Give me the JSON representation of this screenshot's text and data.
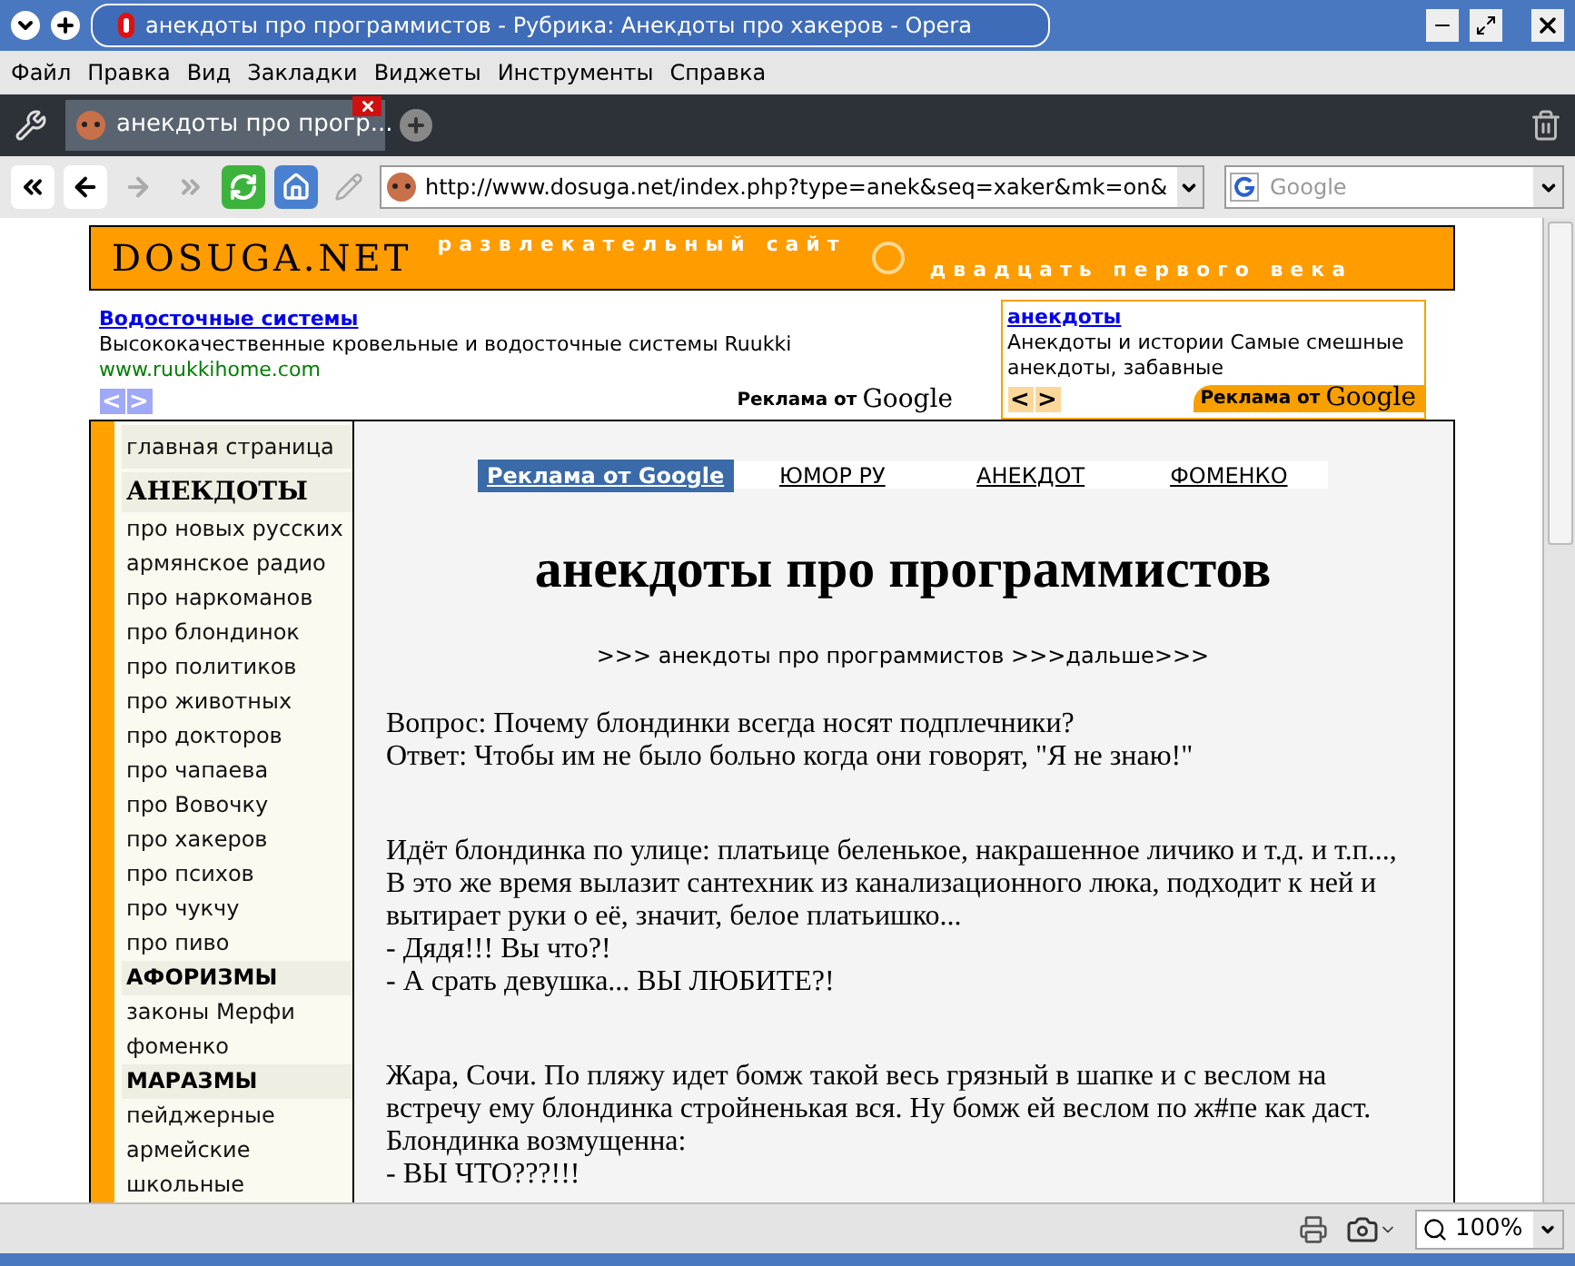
{
  "window": {
    "title": "анекдоты про программистов - Рубрика: Анекдоты про хакеров - Opera"
  },
  "menu": [
    "Файл",
    "Правка",
    "Вид",
    "Закладки",
    "Виджеты",
    "Инструменты",
    "Справка"
  ],
  "tabs": [
    {
      "label": "анекдоты про прогр...",
      "selected": true
    }
  ],
  "address_bar": {
    "url": "http://www.dosuga.net/index.php?type=anek&seq=xaker&mk=on&",
    "search_placeholder": "Google"
  },
  "header": {
    "logo": "DOSUGA.NET",
    "tagline_1": "развлекательный сайт",
    "tagline_2": "двадцать первого века"
  },
  "ad_left": {
    "title": "Водосточные системы",
    "text": "Высококачественные кровельные и водосточные системы Ruukki",
    "url": "www.ruukkihome.com",
    "prev": "<",
    "next": ">",
    "label": "Реклама от",
    "brand": "Google"
  },
  "ad_right": {
    "title": "анекдоты",
    "text": "Анекдоты и истории Самые смешные анекдоты, забавные",
    "prev": "<",
    "next": ">",
    "label": "Реклама от",
    "brand": "Google"
  },
  "sidebar": [
    {
      "kind": "link",
      "label": "главная страница"
    },
    {
      "kind": "heading_serif",
      "label": "АНЕКДОТЫ"
    },
    {
      "kind": "link",
      "label": "про новых русских"
    },
    {
      "kind": "link",
      "label": "армянское радио"
    },
    {
      "kind": "link",
      "label": "про наркоманов"
    },
    {
      "kind": "link",
      "label": "про блондинок"
    },
    {
      "kind": "link",
      "label": "про политиков"
    },
    {
      "kind": "link",
      "label": "про животных"
    },
    {
      "kind": "link",
      "label": "про докторов"
    },
    {
      "kind": "link",
      "label": "про чапаева"
    },
    {
      "kind": "link",
      "label": "про Вовочку"
    },
    {
      "kind": "link",
      "label": "про хакеров"
    },
    {
      "kind": "link",
      "label": "про психов"
    },
    {
      "kind": "link",
      "label": "про чукчу"
    },
    {
      "kind": "link",
      "label": "про пиво"
    },
    {
      "kind": "heading",
      "label": "АФОРИЗМЫ"
    },
    {
      "kind": "link",
      "label": "законы Мерфи"
    },
    {
      "kind": "link",
      "label": "фоменко"
    },
    {
      "kind": "heading",
      "label": "МАРАЗМЫ"
    },
    {
      "kind": "link",
      "label": "пейджерные"
    },
    {
      "kind": "link",
      "label": "армейские"
    },
    {
      "kind": "link",
      "label": "школьные"
    }
  ],
  "nav_links": [
    {
      "label": "Реклама от Google",
      "kind": "ad"
    },
    {
      "label": "ЮМОР РУ",
      "kind": "link"
    },
    {
      "label": "АНЕКДОТ",
      "kind": "link"
    },
    {
      "label": "ФОМЕНКО",
      "kind": "link"
    }
  ],
  "heading": "анекдоты про программистов",
  "breadcrumb": ">>> анекдоты про программистов >>>дальше>>>",
  "jokes": [
    [
      "Вопрос: Почему блондинки всегда носят подплечники?",
      "Ответ: Чтобы им не было больно когда они говорят, \"Я не знаю!\""
    ],
    [
      "Идёт блондинка по улице: платьице беленькое, накрашенное личико и т.д. и т.п..., В это же время вылазит сантехник из канализационного люка, подходит к ней и вытирает руки о её, значит, белое платьишко...",
      "- Дядя!!! Вы что?!",
      "- А срать девушка... ВЫ ЛЮБИТЕ?!"
    ],
    [
      "Жара, Сочи. По пляжу идет бомж такой весь грязный в шапке и с веслом на встречу ему блондинка стройненькая вся. Ну бомж ей веслом по ж#пе как даст. Блондинка возмущенна:",
      "- ВЫ ЧТО???!!!"
    ]
  ],
  "status_bar": {
    "zoom": "100%"
  }
}
